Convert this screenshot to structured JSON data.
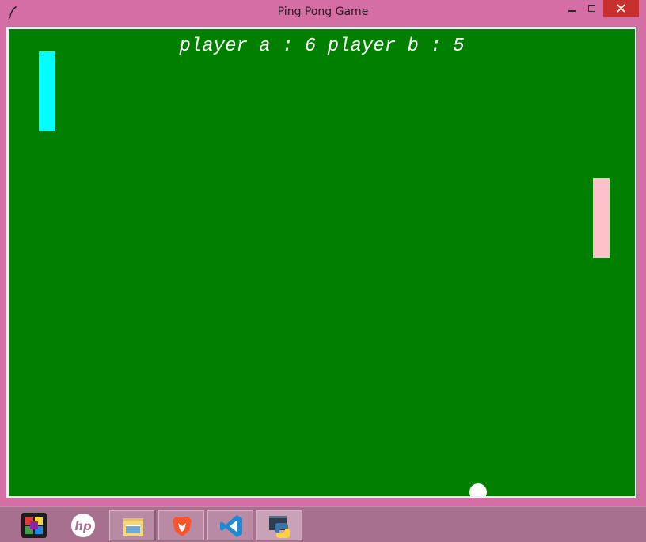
{
  "window": {
    "title": "Ping Pong Game"
  },
  "canvas": {
    "score_text": "player a : 6 player b : 5",
    "player_a_score": 6,
    "player_b_score": 5,
    "colors": {
      "background": "#007f00",
      "paddle_a": "#00ffff",
      "paddle_b": "#ffc0cb",
      "ball": "#ffffff"
    }
  },
  "taskbar": {
    "items": [
      {
        "icon": "puzzle-app-icon"
      },
      {
        "icon": "hp-icon"
      },
      {
        "icon": "file-explorer-icon"
      },
      {
        "icon": "brave-browser-icon"
      },
      {
        "icon": "vscode-icon"
      },
      {
        "icon": "python-icon",
        "active": true
      }
    ]
  }
}
